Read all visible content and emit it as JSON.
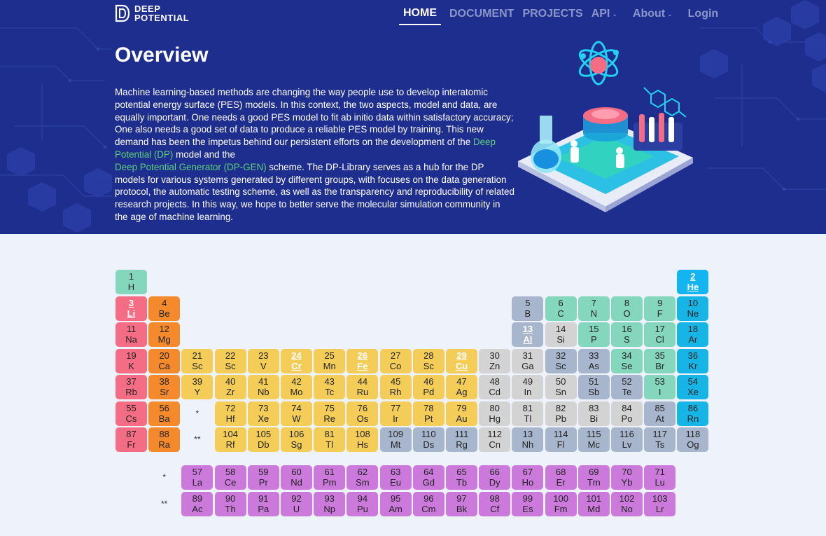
{
  "brand": {
    "line1": "DEEP",
    "line2": "POTENTIAL"
  },
  "nav": [
    {
      "label": "HOME",
      "active": true,
      "dropdown": false
    },
    {
      "label": "DOCUMENT",
      "active": false,
      "dropdown": false
    },
    {
      "label": "PROJECTS",
      "active": false,
      "dropdown": false
    },
    {
      "label": "API",
      "active": false,
      "dropdown": true
    },
    {
      "label": "About",
      "active": false,
      "dropdown": true
    },
    {
      "label": "Login",
      "active": false,
      "dropdown": false
    }
  ],
  "overview": {
    "title": "Overview",
    "p1": "Machine learning-based methods are changing the way people use to develop interatomic potential energy surface (PES) models. In this context, the two aspects, model and data, are equally important. One needs a good PES model to fit ab initio data within satisfactory accuracy; One also needs a good set of data to produce a reliable PES model by training. This new demand has been the impetus behind our persistent efforts on the development of the ",
    "link1": "Deep Potential (DP)",
    "p2": " model and the ",
    "link2": "Deep Potential Generator (DP-GEN)",
    "p3": " scheme. The DP-Library serves as a hub for the DP models for various systems generated by different groups, with focuses on the data generation protocol, the automatic testing scheme, as well as the transparency and reproducibility of related research projects. In this way, we hope to better serve the molecular simulation community in the age of machine learning."
  },
  "colors": {
    "nonmetal": "#84d6bd",
    "alkali": "#f46d84",
    "alkaline": "#f58a2c",
    "transition": "#f4cd59",
    "post": "#d3d3d3",
    "metalloid": "#a7b6cc",
    "noble": "#17b5e6",
    "f": "#cc79dc",
    "linked_noble": "#13b5f1"
  },
  "markers": {
    "lanthanide": "*",
    "actinide": "**"
  },
  "elements": [
    {
      "n": "1",
      "s": "H",
      "r": 1,
      "c": 1,
      "t": "nonmetal"
    },
    {
      "n": "2",
      "s": "He",
      "r": 1,
      "c": 18,
      "t": "noble",
      "link": true
    },
    {
      "n": "3",
      "s": "Li",
      "r": 2,
      "c": 1,
      "t": "alkali",
      "link": true
    },
    {
      "n": "4",
      "s": "Be",
      "r": 2,
      "c": 2,
      "t": "alkaline"
    },
    {
      "n": "5",
      "s": "B",
      "r": 2,
      "c": 13,
      "t": "metalloid"
    },
    {
      "n": "6",
      "s": "C",
      "r": 2,
      "c": 14,
      "t": "nonmetal"
    },
    {
      "n": "7",
      "s": "N",
      "r": 2,
      "c": 15,
      "t": "nonmetal"
    },
    {
      "n": "8",
      "s": "O",
      "r": 2,
      "c": 16,
      "t": "nonmetal"
    },
    {
      "n": "9",
      "s": "F",
      "r": 2,
      "c": 17,
      "t": "nonmetal"
    },
    {
      "n": "10",
      "s": "Ne",
      "r": 2,
      "c": 18,
      "t": "noble"
    },
    {
      "n": "11",
      "s": "Na",
      "r": 3,
      "c": 1,
      "t": "alkali"
    },
    {
      "n": "12",
      "s": "Mg",
      "r": 3,
      "c": 2,
      "t": "alkaline"
    },
    {
      "n": "13",
      "s": "Al",
      "r": 3,
      "c": 13,
      "t": "metalloid",
      "link": true
    },
    {
      "n": "14",
      "s": "Si",
      "r": 3,
      "c": 14,
      "t": "post"
    },
    {
      "n": "15",
      "s": "P",
      "r": 3,
      "c": 15,
      "t": "nonmetal"
    },
    {
      "n": "16",
      "s": "S",
      "r": 3,
      "c": 16,
      "t": "nonmetal"
    },
    {
      "n": "17",
      "s": "Cl",
      "r": 3,
      "c": 17,
      "t": "nonmetal"
    },
    {
      "n": "18",
      "s": "Ar",
      "r": 3,
      "c": 18,
      "t": "noble"
    },
    {
      "n": "19",
      "s": "K",
      "r": 4,
      "c": 1,
      "t": "alkali"
    },
    {
      "n": "20",
      "s": "Ca",
      "r": 4,
      "c": 2,
      "t": "alkaline"
    },
    {
      "n": "21",
      "s": "Sc",
      "r": 4,
      "c": 3,
      "t": "transition"
    },
    {
      "n": "22",
      "s": "Sc",
      "r": 4,
      "c": 4,
      "t": "transition"
    },
    {
      "n": "23",
      "s": "V",
      "r": 4,
      "c": 5,
      "t": "transition"
    },
    {
      "n": "24",
      "s": "Cr",
      "r": 4,
      "c": 6,
      "t": "transition",
      "link": true
    },
    {
      "n": "25",
      "s": "Mn",
      "r": 4,
      "c": 7,
      "t": "transition"
    },
    {
      "n": "26",
      "s": "Fe",
      "r": 4,
      "c": 8,
      "t": "transition",
      "link": true
    },
    {
      "n": "27",
      "s": "Co",
      "r": 4,
      "c": 9,
      "t": "transition"
    },
    {
      "n": "28",
      "s": "Sc",
      "r": 4,
      "c": 10,
      "t": "transition"
    },
    {
      "n": "29",
      "s": "Cu",
      "r": 4,
      "c": 11,
      "t": "transition",
      "link": true
    },
    {
      "n": "30",
      "s": "Zn",
      "r": 4,
      "c": 12,
      "t": "post"
    },
    {
      "n": "31",
      "s": "Ga",
      "r": 4,
      "c": 13,
      "t": "post"
    },
    {
      "n": "32",
      "s": "Sc",
      "r": 4,
      "c": 14,
      "t": "metalloid"
    },
    {
      "n": "33",
      "s": "As",
      "r": 4,
      "c": 15,
      "t": "metalloid"
    },
    {
      "n": "34",
      "s": "Se",
      "r": 4,
      "c": 16,
      "t": "nonmetal"
    },
    {
      "n": "35",
      "s": "Br",
      "r": 4,
      "c": 17,
      "t": "nonmetal"
    },
    {
      "n": "36",
      "s": "Kr",
      "r": 4,
      "c": 18,
      "t": "noble"
    },
    {
      "n": "37",
      "s": "Rb",
      "r": 5,
      "c": 1,
      "t": "alkali"
    },
    {
      "n": "38",
      "s": "Sr",
      "r": 5,
      "c": 2,
      "t": "alkaline"
    },
    {
      "n": "39",
      "s": "Y",
      "r": 5,
      "c": 3,
      "t": "transition"
    },
    {
      "n": "40",
      "s": "Zr",
      "r": 5,
      "c": 4,
      "t": "transition"
    },
    {
      "n": "41",
      "s": "Nb",
      "r": 5,
      "c": 5,
      "t": "transition"
    },
    {
      "n": "42",
      "s": "Mo",
      "r": 5,
      "c": 6,
      "t": "transition"
    },
    {
      "n": "43",
      "s": "Tc",
      "r": 5,
      "c": 7,
      "t": "transition"
    },
    {
      "n": "44",
      "s": "Ru",
      "r": 5,
      "c": 8,
      "t": "transition"
    },
    {
      "n": "45",
      "s": "Rh",
      "r": 5,
      "c": 9,
      "t": "transition"
    },
    {
      "n": "46",
      "s": "Pd",
      "r": 5,
      "c": 10,
      "t": "transition"
    },
    {
      "n": "47",
      "s": "Ag",
      "r": 5,
      "c": 11,
      "t": "transition"
    },
    {
      "n": "48",
      "s": "Cd",
      "r": 5,
      "c": 12,
      "t": "post"
    },
    {
      "n": "49",
      "s": "In",
      "r": 5,
      "c": 13,
      "t": "post"
    },
    {
      "n": "50",
      "s": "Sn",
      "r": 5,
      "c": 14,
      "t": "post"
    },
    {
      "n": "51",
      "s": "Sb",
      "r": 5,
      "c": 15,
      "t": "metalloid"
    },
    {
      "n": "52",
      "s": "Te",
      "r": 5,
      "c": 16,
      "t": "metalloid"
    },
    {
      "n": "53",
      "s": "I",
      "r": 5,
      "c": 17,
      "t": "nonmetal"
    },
    {
      "n": "54",
      "s": "Xe",
      "r": 5,
      "c": 18,
      "t": "noble"
    },
    {
      "n": "55",
      "s": "Cs",
      "r": 6,
      "c": 1,
      "t": "alkali"
    },
    {
      "n": "56",
      "s": "Ba",
      "r": 6,
      "c": 2,
      "t": "alkaline"
    },
    {
      "n": "72",
      "s": "Hf",
      "r": 6,
      "c": 4,
      "t": "transition"
    },
    {
      "n": "73",
      "s": "Xe",
      "r": 6,
      "c": 5,
      "t": "transition"
    },
    {
      "n": "74",
      "s": "W",
      "r": 6,
      "c": 6,
      "t": "transition"
    },
    {
      "n": "75",
      "s": "Re",
      "r": 6,
      "c": 7,
      "t": "transition"
    },
    {
      "n": "76",
      "s": "Os",
      "r": 6,
      "c": 8,
      "t": "transition"
    },
    {
      "n": "77",
      "s": "Ir",
      "r": 6,
      "c": 9,
      "t": "transition"
    },
    {
      "n": "78",
      "s": "Pt",
      "r": 6,
      "c": 10,
      "t": "transition"
    },
    {
      "n": "79",
      "s": "Au",
      "r": 6,
      "c": 11,
      "t": "transition"
    },
    {
      "n": "80",
      "s": "Hg",
      "r": 6,
      "c": 12,
      "t": "post"
    },
    {
      "n": "81",
      "s": "Tl",
      "r": 6,
      "c": 13,
      "t": "post"
    },
    {
      "n": "82",
      "s": "Pb",
      "r": 6,
      "c": 14,
      "t": "post"
    },
    {
      "n": "83",
      "s": "Bi",
      "r": 6,
      "c": 15,
      "t": "post"
    },
    {
      "n": "84",
      "s": "Po",
      "r": 6,
      "c": 16,
      "t": "post"
    },
    {
      "n": "85",
      "s": "At",
      "r": 6,
      "c": 17,
      "t": "metalloid"
    },
    {
      "n": "86",
      "s": "Rn",
      "r": 6,
      "c": 18,
      "t": "noble"
    },
    {
      "n": "87",
      "s": "Fr",
      "r": 7,
      "c": 1,
      "t": "alkali"
    },
    {
      "n": "88",
      "s": "Ra",
      "r": 7,
      "c": 2,
      "t": "alkaline"
    },
    {
      "n": "104",
      "s": "Rf",
      "r": 7,
      "c": 4,
      "t": "transition"
    },
    {
      "n": "105",
      "s": "Db",
      "r": 7,
      "c": 5,
      "t": "transition"
    },
    {
      "n": "106",
      "s": "Sg",
      "r": 7,
      "c": 6,
      "t": "transition"
    },
    {
      "n": "81",
      "s": "Tl",
      "r": 7,
      "c": 7,
      "t": "transition"
    },
    {
      "n": "108",
      "s": "Hs",
      "r": 7,
      "c": 8,
      "t": "transition"
    },
    {
      "n": "109",
      "s": "Mt",
      "r": 7,
      "c": 9,
      "t": "metalloid"
    },
    {
      "n": "110",
      "s": "Ds",
      "r": 7,
      "c": 10,
      "t": "metalloid"
    },
    {
      "n": "111",
      "s": "Rg",
      "r": 7,
      "c": 11,
      "t": "metalloid"
    },
    {
      "n": "112",
      "s": "Cn",
      "r": 7,
      "c": 12,
      "t": "post"
    },
    {
      "n": "13",
      "s": "Nh",
      "r": 7,
      "c": 13,
      "t": "metalloid"
    },
    {
      "n": "114",
      "s": "Fl",
      "r": 7,
      "c": 14,
      "t": "metalloid"
    },
    {
      "n": "115",
      "s": "Mc",
      "r": 7,
      "c": 15,
      "t": "metalloid"
    },
    {
      "n": "116",
      "s": "Lv",
      "r": 7,
      "c": 16,
      "t": "metalloid"
    },
    {
      "n": "117",
      "s": "Ts",
      "r": 7,
      "c": 17,
      "t": "metalloid"
    },
    {
      "n": "118",
      "s": "Og",
      "r": 7,
      "c": 18,
      "t": "metalloid"
    },
    {
      "n": "57",
      "s": "La",
      "r": 9,
      "c": 3,
      "t": "f"
    },
    {
      "n": "58",
      "s": "Ce",
      "r": 9,
      "c": 4,
      "t": "f"
    },
    {
      "n": "59",
      "s": "Pr",
      "r": 9,
      "c": 5,
      "t": "f"
    },
    {
      "n": "60",
      "s": "Nd",
      "r": 9,
      "c": 6,
      "t": "f"
    },
    {
      "n": "61",
      "s": "Pm",
      "r": 9,
      "c": 7,
      "t": "f"
    },
    {
      "n": "62",
      "s": "Sm",
      "r": 9,
      "c": 8,
      "t": "f"
    },
    {
      "n": "63",
      "s": "Eu",
      "r": 9,
      "c": 9,
      "t": "f"
    },
    {
      "n": "64",
      "s": "Gd",
      "r": 9,
      "c": 10,
      "t": "f"
    },
    {
      "n": "65",
      "s": "Tb",
      "r": 9,
      "c": 11,
      "t": "f"
    },
    {
      "n": "66",
      "s": "Dy",
      "r": 9,
      "c": 12,
      "t": "f"
    },
    {
      "n": "67",
      "s": "Ho",
      "r": 9,
      "c": 13,
      "t": "f"
    },
    {
      "n": "68",
      "s": "Er",
      "r": 9,
      "c": 14,
      "t": "f"
    },
    {
      "n": "69",
      "s": "Tm",
      "r": 9,
      "c": 15,
      "t": "f"
    },
    {
      "n": "70",
      "s": "Yb",
      "r": 9,
      "c": 16,
      "t": "f"
    },
    {
      "n": "71",
      "s": "Lu",
      "r": 9,
      "c": 17,
      "t": "f"
    },
    {
      "n": "89",
      "s": "Ac",
      "r": 10,
      "c": 3,
      "t": "f"
    },
    {
      "n": "90",
      "s": "Th",
      "r": 10,
      "c": 4,
      "t": "f"
    },
    {
      "n": "91",
      "s": "Pa",
      "r": 10,
      "c": 5,
      "t": "f"
    },
    {
      "n": "92",
      "s": "U",
      "r": 10,
      "c": 6,
      "t": "f"
    },
    {
      "n": "93",
      "s": "Np",
      "r": 10,
      "c": 7,
      "t": "f"
    },
    {
      "n": "94",
      "s": "Pu",
      "r": 10,
      "c": 8,
      "t": "f"
    },
    {
      "n": "95",
      "s": "Am",
      "r": 10,
      "c": 9,
      "t": "f"
    },
    {
      "n": "96",
      "s": "Cm",
      "r": 10,
      "c": 10,
      "t": "f"
    },
    {
      "n": "97",
      "s": "Bk",
      "r": 10,
      "c": 11,
      "t": "f"
    },
    {
      "n": "98",
      "s": "Cf",
      "r": 10,
      "c": 12,
      "t": "f"
    },
    {
      "n": "99",
      "s": "Es",
      "r": 10,
      "c": 13,
      "t": "f"
    },
    {
      "n": "100",
      "s": "Fm",
      "r": 10,
      "c": 14,
      "t": "f"
    },
    {
      "n": "101",
      "s": "Md",
      "r": 10,
      "c": 15,
      "t": "f"
    },
    {
      "n": "102",
      "s": "No",
      "r": 10,
      "c": 16,
      "t": "f"
    },
    {
      "n": "103",
      "s": "Lr",
      "r": 10,
      "c": 17,
      "t": "f"
    }
  ]
}
